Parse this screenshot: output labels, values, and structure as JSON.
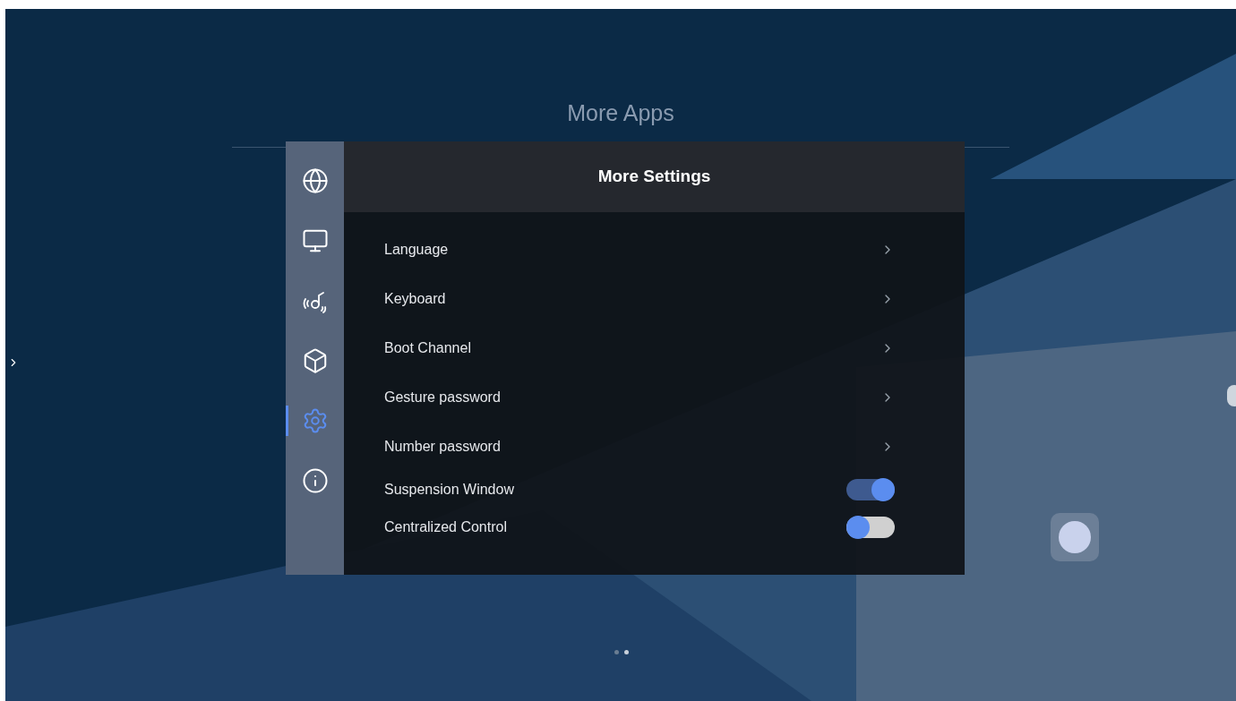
{
  "launcher": {
    "title": "More Apps",
    "page_dots": [
      {
        "selected": false
      },
      {
        "selected": true
      }
    ]
  },
  "dialog": {
    "title": "More Settings",
    "sidebar": [
      {
        "kind": "globe",
        "selected": false
      },
      {
        "kind": "monitor",
        "selected": false
      },
      {
        "kind": "signal",
        "selected": false
      },
      {
        "kind": "cube",
        "selected": false
      },
      {
        "kind": "gear",
        "selected": true
      },
      {
        "kind": "info",
        "selected": false
      }
    ],
    "rows": [
      {
        "kind": "link",
        "label": "Language"
      },
      {
        "kind": "link",
        "label": "Keyboard"
      },
      {
        "kind": "link",
        "label": "Boot Channel"
      },
      {
        "kind": "link",
        "label": "Gesture password"
      },
      {
        "kind": "link",
        "label": "Number password"
      },
      {
        "kind": "toggle",
        "label": "Suspension Window",
        "on": true
      },
      {
        "kind": "toggle",
        "label": "Centralized Control",
        "on": false
      }
    ]
  }
}
